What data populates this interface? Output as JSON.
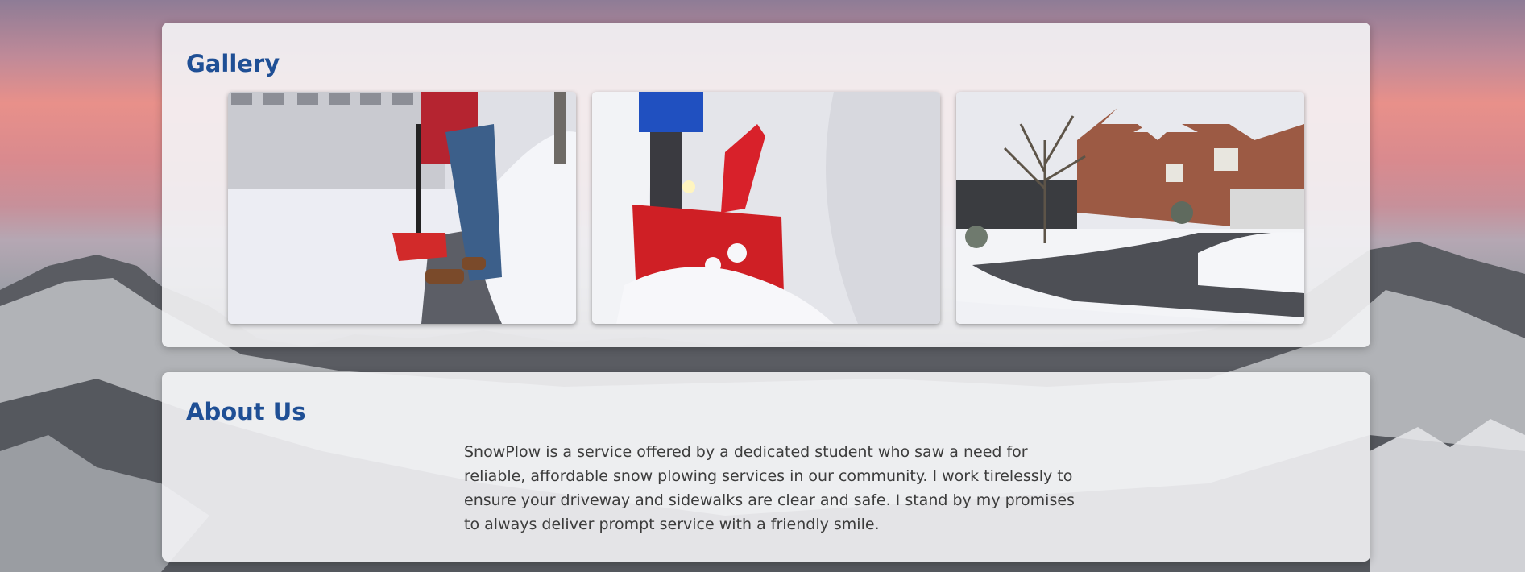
{
  "gallery": {
    "title": "Gallery",
    "images": [
      {
        "name": "shoveling-photo"
      },
      {
        "name": "snowblower-photo"
      },
      {
        "name": "cleared-driveway-photo"
      }
    ]
  },
  "about": {
    "title": "About Us",
    "body": "SnowPlow is a service offered by a dedicated student who saw a need for reliable, affordable snow plowing services in our community. I work tirelessly to ensure your driveway and sidewalks are clear and safe. I stand by my promises to always deliver prompt service with a friendly smile."
  },
  "colors": {
    "heading": "#1f4f95",
    "text": "#3c3c3c",
    "panel": "#f4f4f6"
  }
}
